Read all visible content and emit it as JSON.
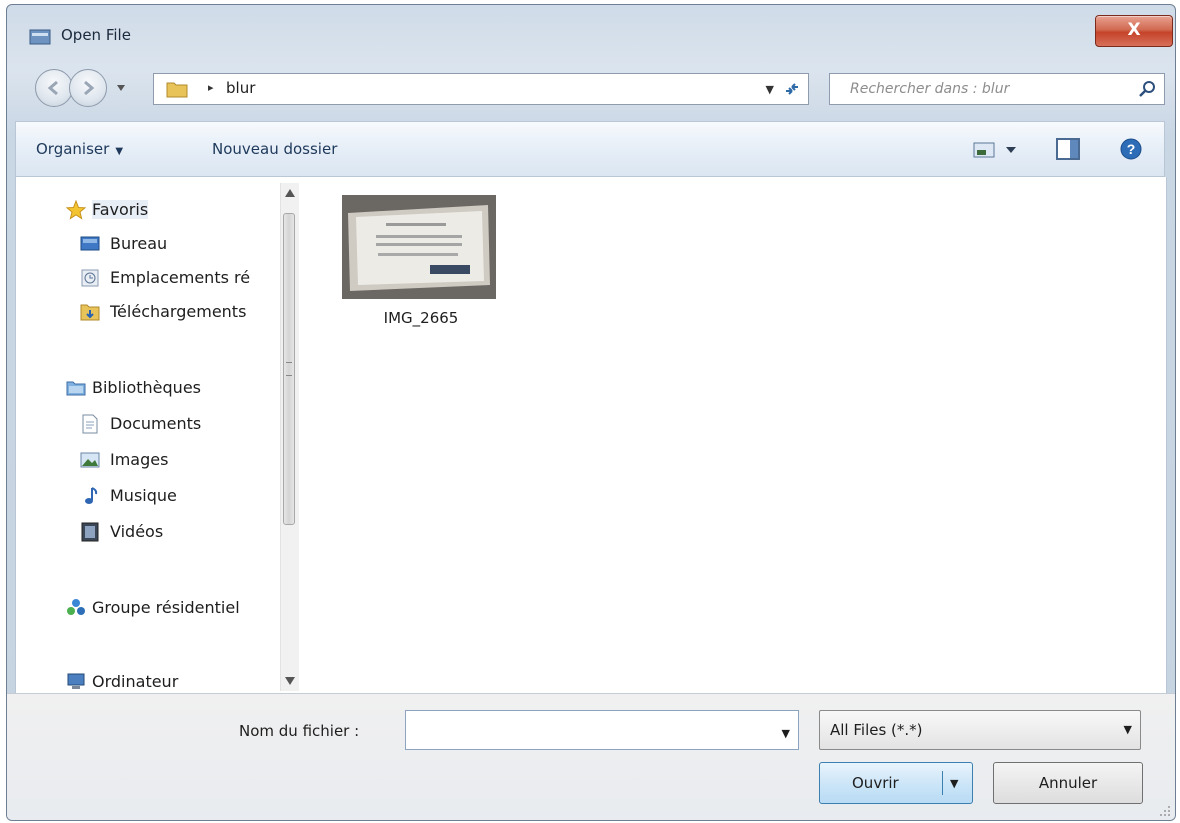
{
  "window": {
    "title": "Open File",
    "close_label": "X"
  },
  "address": {
    "crumb": "blur",
    "separator": "▸"
  },
  "search": {
    "placeholder": "Rechercher dans : blur"
  },
  "toolbar": {
    "organize": "Organiser",
    "organize_caret": "▼",
    "new_folder": "Nouveau dossier"
  },
  "sidebar": {
    "items": [
      {
        "label": "Favoris",
        "icon": "star-icon"
      },
      {
        "label": "Bureau",
        "icon": "desktop-icon"
      },
      {
        "label": "Emplacements ré",
        "icon": "recent-places-icon"
      },
      {
        "label": "Téléchargements",
        "icon": "downloads-icon"
      },
      {
        "label": "Bibliothèques",
        "icon": "libraries-icon"
      },
      {
        "label": "Documents",
        "icon": "document-icon"
      },
      {
        "label": "Images",
        "icon": "images-icon"
      },
      {
        "label": "Musique",
        "icon": "music-icon"
      },
      {
        "label": "Vidéos",
        "icon": "video-icon"
      },
      {
        "label": "Groupe résidentiel",
        "icon": "homegroup-icon"
      },
      {
        "label": "Ordinateur",
        "icon": "computer-icon"
      }
    ]
  },
  "files": [
    {
      "name": "IMG_2665"
    }
  ],
  "bottom": {
    "filename_label": "Nom du fichier :",
    "filename_value": "",
    "filetype": "All Files (*.*)",
    "open_label": "Ouvrir",
    "cancel_label": "Annuler"
  },
  "colors": {
    "accent": "#3c7fb1",
    "close": "#c4432a",
    "toolbar": "#e6eef7"
  }
}
